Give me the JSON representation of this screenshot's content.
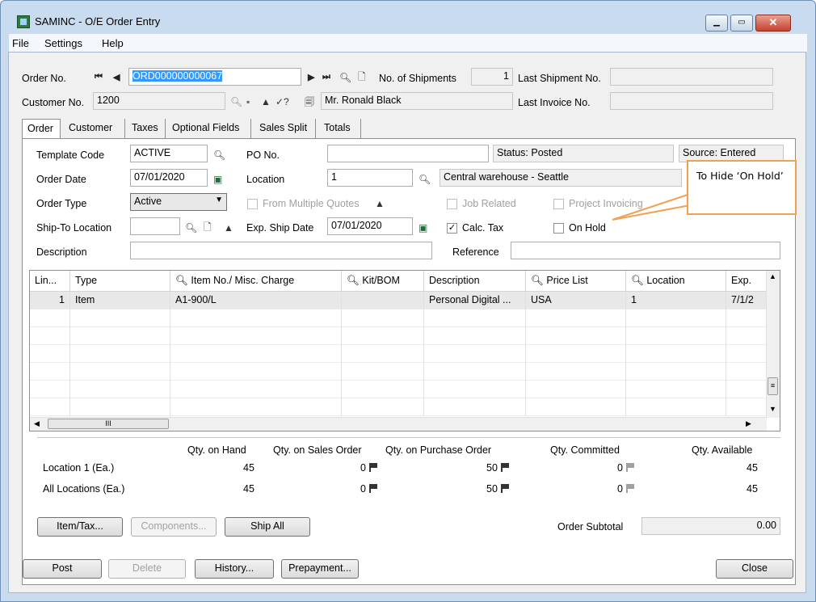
{
  "window": {
    "title": "SAMINC - O/E Order Entry"
  },
  "menu": [
    "File",
    "Settings",
    "Help"
  ],
  "header": {
    "order_no_label": "Order No.",
    "order_no_value": "ORD000000000067",
    "shipments_label": "No. of Shipments",
    "shipments_value": "1",
    "last_shipment_label": "Last Shipment No.",
    "last_shipment_value": "",
    "customer_no_label": "Customer No.",
    "customer_no_value": "1200",
    "customer_name": "Mr. Ronald Black",
    "last_invoice_label": "Last Invoice No.",
    "last_invoice_value": ""
  },
  "tabs": [
    "Order",
    "Customer",
    "Taxes",
    "Optional Fields",
    "Sales Split",
    "Totals"
  ],
  "order": {
    "template_code_label": "Template Code",
    "template_code_value": "ACTIVE",
    "po_no_label": "PO No.",
    "po_no_value": "",
    "status": "Status: Posted",
    "source": "Source: Entered",
    "order_date_label": "Order Date",
    "order_date_value": "07/01/2020",
    "location_label": "Location",
    "location_value": "1",
    "location_desc": "Central warehouse - Seattle",
    "order_type_label": "Order Type",
    "order_type_value": "Active",
    "from_multiple_quotes": "From Multiple Quotes",
    "job_related": "Job Related",
    "project_invoicing": "Project Invoicing",
    "ship_to_label": "Ship-To Location",
    "ship_to_value": "",
    "exp_ship_date_label": "Exp. Ship Date",
    "exp_ship_date_value": "07/01/2020",
    "calc_tax": "Calc. Tax",
    "calc_tax_checked": true,
    "on_hold": "On Hold",
    "on_hold_checked": false,
    "description_label": "Description",
    "description_value": "",
    "reference_label": "Reference",
    "reference_value": ""
  },
  "grid": {
    "headers": [
      "Lin...",
      "Type",
      "Item No./ Misc. Charge",
      "Kit/BOM",
      "Description",
      "Price List",
      "Location",
      "Exp."
    ],
    "rows": [
      {
        "line": "1",
        "type": "Item",
        "item": "A1-900/L",
        "kit": "",
        "description": "Personal Digital ...",
        "price_list": "USA",
        "location": "1",
        "exp": "7/1/2"
      }
    ],
    "hscroll_label": "III"
  },
  "qty": {
    "headers": [
      "Qty. on Hand",
      "Qty. on Sales Order",
      "Qty. on Purchase Order",
      "Qty. Committed",
      "Qty. Available"
    ],
    "rows": [
      {
        "label": "Location  1 (Ea.)",
        "on_hand": "45",
        "on_sales": "0",
        "on_purchase": "50",
        "committed": "0",
        "available": "45"
      },
      {
        "label": "All Locations (Ea.)",
        "on_hand": "45",
        "on_sales": "0",
        "on_purchase": "50",
        "committed": "0",
        "available": "45"
      }
    ]
  },
  "buttons": {
    "item_tax": "Item/Tax...",
    "components": "Components...",
    "ship_all": "Ship All",
    "order_subtotal_label": "Order Subtotal",
    "order_subtotal_value": "0.00",
    "post": "Post",
    "delete": "Delete",
    "history": "History...",
    "prepayment": "Prepayment...",
    "close": "Close"
  },
  "callout": {
    "text": "To Hide ‘On Hold’",
    "border_color": "#f0a050"
  }
}
